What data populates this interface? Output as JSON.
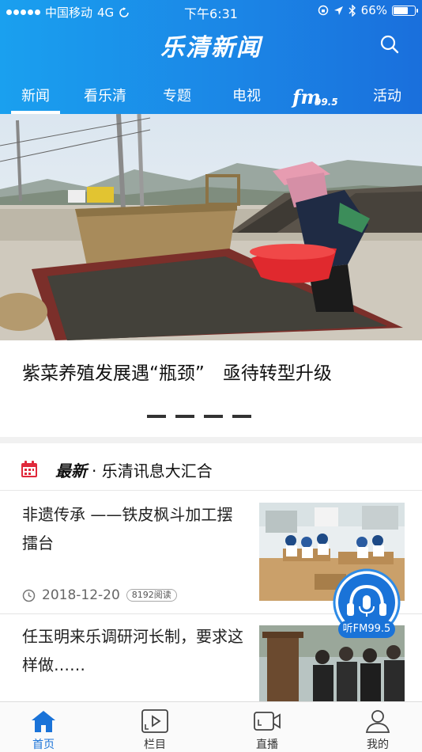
{
  "status_bar": {
    "carrier": "中国移动",
    "network": "4G",
    "time": "下午6:31",
    "battery": "66%",
    "battery_level": 0.66
  },
  "header": {
    "app_title": "乐清新闻",
    "search_icon": "search-icon"
  },
  "tabs": [
    {
      "label": "新闻",
      "active": true
    },
    {
      "label": "看乐清",
      "active": false
    },
    {
      "label": "专题",
      "active": false
    },
    {
      "label": "电视",
      "active": false
    },
    {
      "label": "FM 99.5",
      "logo": true,
      "active": false
    },
    {
      "label": "活动",
      "active": false
    }
  ],
  "fm_logo": {
    "fm": "fm",
    "num": "99.5"
  },
  "hero": {
    "title": "紫菜养殖发展遇“瓶颈”　亟待转型升级",
    "slide_count": 4
  },
  "section": {
    "title_strong": "最新",
    "title_sub": "· 乐清讯息大汇合"
  },
  "news": [
    {
      "title": "非遗传承 ——铁皮枫斗加工摆擂台",
      "date": "2018-12-20",
      "reads": "8192阅读"
    },
    {
      "title": "任玉明来乐调研河长制，要求这样做……"
    }
  ],
  "fm_float": {
    "label": "听FM99.5"
  },
  "tabbar": [
    {
      "label": "首页",
      "icon": "home-icon",
      "active": true
    },
    {
      "label": "栏目",
      "icon": "column-icon",
      "active": false
    },
    {
      "label": "直播",
      "icon": "live-icon",
      "active": false
    },
    {
      "label": "我的",
      "icon": "profile-icon",
      "active": false
    }
  ],
  "colors": {
    "accent": "#1a73d8",
    "header": "#1b86e6"
  }
}
